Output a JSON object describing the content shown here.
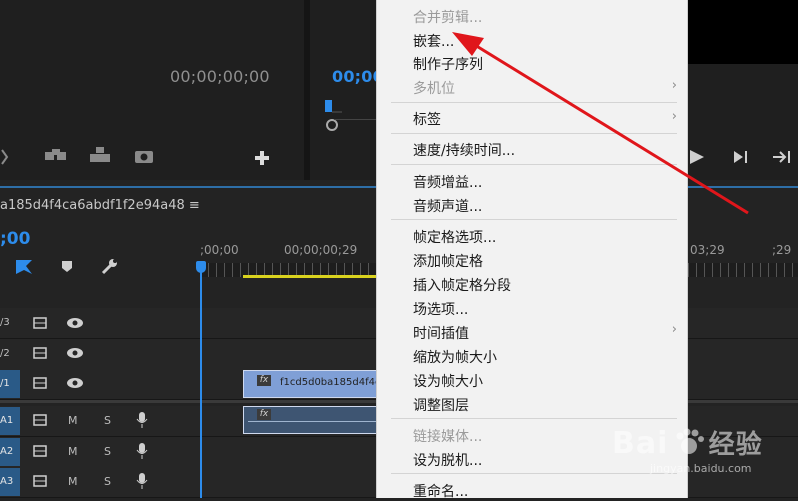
{
  "source_monitor": {
    "timecode": "00;00;00;00",
    "buttons": [
      "insert-icon",
      "overwrite-icon",
      "export-frame-icon",
      "add-button-icon"
    ]
  },
  "program_monitor": {
    "timecode": "00;00",
    "buttons": [
      "play-icon",
      "step-forward-icon",
      "go-to-out-icon"
    ]
  },
  "timeline": {
    "sequence_name": "a185d4f4ca6abdf1f2e94a48 ≡",
    "timecode": ";00",
    "ruler_labels": [
      ";00;00",
      "00;00;00;29",
      "03;29",
      ";29"
    ],
    "tracks": [
      {
        "label": "V3",
        "display": "/3"
      },
      {
        "label": "V2",
        "display": "/2"
      },
      {
        "label": "V1",
        "display": "/1"
      },
      {
        "label": "A1",
        "display": "A1"
      },
      {
        "label": "A2",
        "display": "A2"
      },
      {
        "label": "A3",
        "display": "A3"
      }
    ],
    "mute_label": "M",
    "solo_label": "S",
    "video_clip": {
      "fx": "fx",
      "name": "f1cd5d0ba185d4f4ca"
    },
    "audio_clip": {
      "fx": "fx"
    }
  },
  "context_menu": {
    "items": [
      {
        "label": "合并剪辑...",
        "disabled": true,
        "submenu": false
      },
      {
        "label": "嵌套...",
        "disabled": false,
        "submenu": false
      },
      {
        "label": "制作子序列",
        "disabled": false,
        "submenu": false
      },
      {
        "label": "多机位",
        "disabled": true,
        "submenu": true
      },
      {
        "label": "标签",
        "disabled": false,
        "submenu": true
      },
      {
        "label": "速度/持续时间...",
        "disabled": false,
        "submenu": false
      },
      {
        "label": "音频增益...",
        "disabled": false,
        "submenu": false
      },
      {
        "label": "音频声道...",
        "disabled": false,
        "submenu": false
      },
      {
        "label": "帧定格选项...",
        "disabled": false,
        "submenu": false
      },
      {
        "label": "添加帧定格",
        "disabled": false,
        "submenu": false
      },
      {
        "label": "插入帧定格分段",
        "disabled": false,
        "submenu": false
      },
      {
        "label": "场选项...",
        "disabled": false,
        "submenu": false
      },
      {
        "label": "时间插值",
        "disabled": false,
        "submenu": true
      },
      {
        "label": "缩放为帧大小",
        "disabled": false,
        "submenu": false
      },
      {
        "label": "设为帧大小",
        "disabled": false,
        "submenu": false
      },
      {
        "label": "调整图层",
        "disabled": false,
        "submenu": false
      },
      {
        "label": "链接媒体...",
        "disabled": true,
        "submenu": false
      },
      {
        "label": "设为脱机...",
        "disabled": false,
        "submenu": false
      },
      {
        "label": "重命名...",
        "disabled": false,
        "submenu": false
      }
    ],
    "chevron": "›"
  },
  "watermark": {
    "brand": "Bai",
    "brand2": "经验",
    "url": "jingyan.baidu.com"
  },
  "annotation": {
    "arrow_color": "#e0161b"
  },
  "colors": {
    "accent": "#2d8ceb",
    "work_area": "#d9d21e",
    "menu_bg": "#f2f2f2"
  }
}
